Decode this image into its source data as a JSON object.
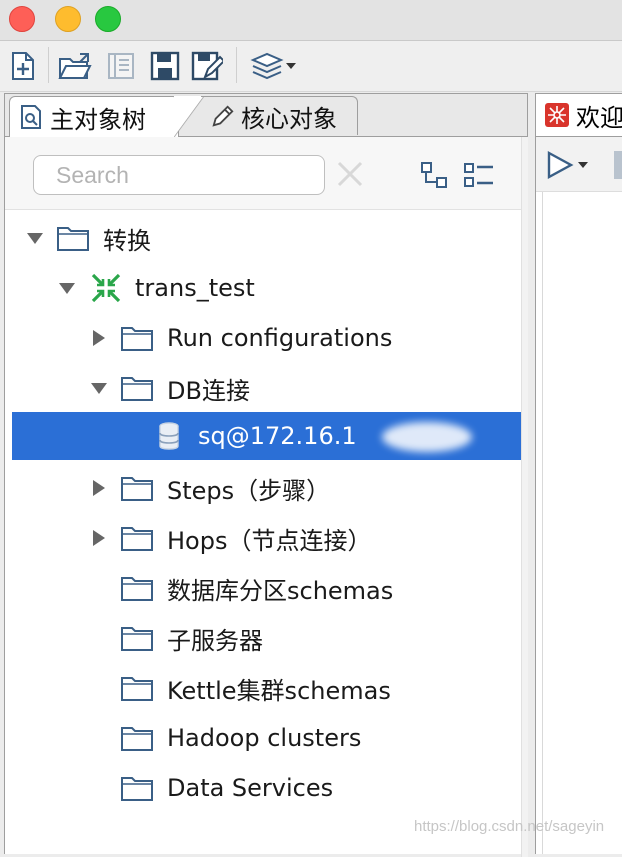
{
  "left_panel": {
    "tabs": [
      {
        "label": "主对象树",
        "icon": "tree-search-icon",
        "active": true
      },
      {
        "label": "核心对象",
        "icon": "pencil-icon",
        "active": false
      }
    ],
    "search": {
      "placeholder": "Search",
      "value": ""
    }
  },
  "tree": [
    {
      "label": "转换",
      "icon": "folder-icon",
      "expanded": true
    },
    {
      "label": "trans_test",
      "icon": "transformation-icon",
      "expanded": true
    },
    {
      "label": "Run configurations",
      "icon": "folder-icon",
      "expanded": false
    },
    {
      "label": "DB连接",
      "icon": "folder-icon",
      "expanded": true
    },
    {
      "label": "sq@172.16.1",
      "icon": "database-icon",
      "selected": true
    },
    {
      "label": "Steps（步骤）",
      "icon": "folder-icon",
      "expanded": false
    },
    {
      "label": "Hops（节点连接）",
      "icon": "folder-icon",
      "expanded": false
    },
    {
      "label": "数据库分区schemas",
      "icon": "folder-icon"
    },
    {
      "label": "子服务器",
      "icon": "folder-icon"
    },
    {
      "label": "Kettle集群schemas",
      "icon": "folder-icon"
    },
    {
      "label": "Hadoop clusters",
      "icon": "folder-icon"
    },
    {
      "label": "Data Services",
      "icon": "folder-icon"
    }
  ],
  "right_panel": {
    "tab_label": "欢迎"
  },
  "watermark": "https://blog.csdn.net/sageyin",
  "colors": {
    "selection": "#2b6fd6",
    "accent_red": "#d9342b",
    "transform_green": "#2aa64a"
  }
}
